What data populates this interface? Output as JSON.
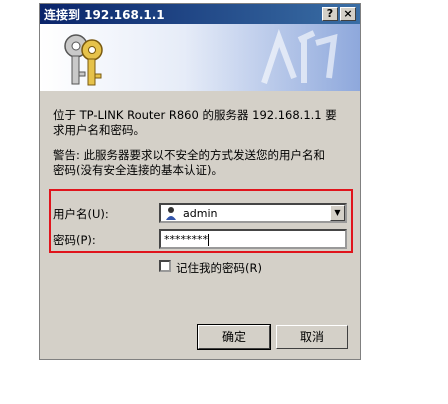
{
  "dialog": {
    "title": "连接到 192.168.1.1",
    "help_label": "?",
    "close_label": "×",
    "message_line1": "位于 TP-LINK Router R860 的服务器 192.168.1.1 要",
    "message_line2": "求用户名和密码。",
    "warning_line1": "警告: 此服务器要求以不安全的方式发送您的用户名和",
    "warning_line2": "密码(没有安全连接的基本认证)。",
    "username_label": "用户名(U):",
    "username_value": "admin",
    "password_label": "密码(P):",
    "password_value": "********",
    "remember_label": "记住我的密码(R)",
    "remember_checked": false,
    "ok_label": "确定",
    "cancel_label": "取消"
  },
  "colors": {
    "title_bar": "#0a246a",
    "highlight_border": "#e0141c",
    "dialog_bg": "#d4d0c8"
  },
  "icons": [
    "keys-icon",
    "user-icon",
    "dropdown-arrow-icon"
  ]
}
